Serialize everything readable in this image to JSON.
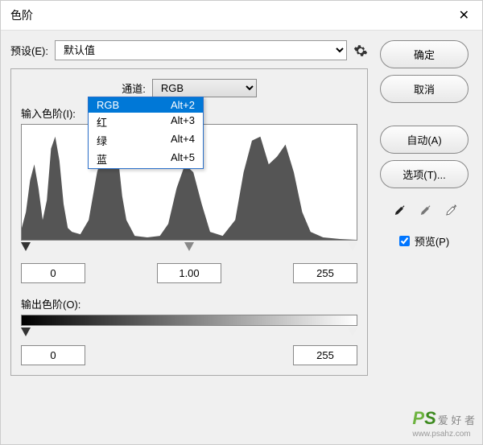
{
  "title": "色阶",
  "preset_label": "预设(E):",
  "preset_value": "默认值",
  "channel_label": "通道:",
  "channel_value": "RGB",
  "input_label": "输入色阶(I):",
  "output_label": "输出色阶(O):",
  "input_black": "0",
  "input_mid": "1.00",
  "input_white": "255",
  "output_black": "0",
  "output_white": "255",
  "buttons": {
    "ok": "确定",
    "cancel": "取消",
    "auto": "自动(A)",
    "options": "选项(T)..."
  },
  "preview_label": "预览(P)",
  "dropdown": [
    {
      "label": "RGB",
      "shortcut": "Alt+2",
      "selected": true
    },
    {
      "label": "红",
      "shortcut": "Alt+3",
      "selected": false
    },
    {
      "label": "绿",
      "shortcut": "Alt+4",
      "selected": false
    },
    {
      "label": "蓝",
      "shortcut": "Alt+5",
      "selected": false
    }
  ],
  "watermark": {
    "brand1": "P",
    "brand2": "S",
    "sub": "爱 好 者",
    "url": "www.psahz.com"
  }
}
